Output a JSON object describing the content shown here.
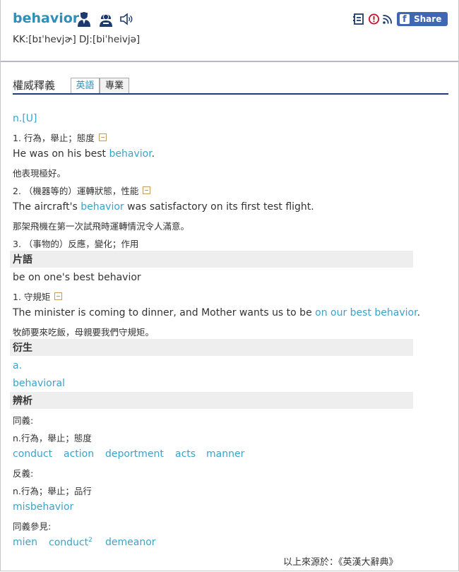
{
  "header": {
    "word": "behavior",
    "phonetic": "KK:[bɪˈhevjɚ] DJ:[biˈheivjə]",
    "voice_icons": [
      "male-voice-icon",
      "female-voice-icon",
      "speaker-icon"
    ],
    "tool_icons": [
      "notebook-icon",
      "report-icon",
      "rss-icon"
    ],
    "share_label": "Share 0"
  },
  "section": {
    "title": "權威釋義",
    "tabs": [
      {
        "label": "英語",
        "active": true
      },
      {
        "label": "專業",
        "active": false
      }
    ]
  },
  "entry": {
    "pos": "n.[U]",
    "senses": [
      {
        "num": "1.",
        "def": "行為，舉止；態度",
        "ex_pre": "He was on his best ",
        "ex_hl": "behavior",
        "ex_post": ".",
        "ex_zh": "他表現極好。"
      },
      {
        "num": "2.",
        "def": "（機器等的）運轉狀態，性能",
        "ex_pre": "The aircraft's ",
        "ex_hl": "behavior",
        "ex_post": " was satisfactory on its first test flight.",
        "ex_zh": "那架飛機在第一次試飛時運轉情況令人滿意。"
      },
      {
        "num": "3.",
        "def": "（事物的）反應，變化；作用"
      }
    ]
  },
  "phrases": {
    "heading": "片語",
    "phrase": "be on one's best behavior",
    "num": "1.",
    "def": "守規矩",
    "ex_pre": "The minister is coming to dinner, and Mother wants us to be ",
    "ex_hl": "on our best behavior",
    "ex_post": ".",
    "ex_zh": "牧師要來吃飯，母親要我們守規矩。"
  },
  "derived": {
    "heading": "衍生",
    "pos": "a.",
    "word": "behavioral"
  },
  "analysis": {
    "heading": "辨析",
    "syn_label": "同義:",
    "syn_def": "n.行為，舉止；態度",
    "synonyms": [
      "conduct",
      "action",
      "deportment",
      "acts",
      "manner"
    ],
    "ant_label": "反義:",
    "ant_def": "n.行為；舉止；品行",
    "antonyms": [
      "misbehavior"
    ],
    "see_label": "同義參見:",
    "see_also": [
      {
        "word": "mien",
        "sup": ""
      },
      {
        "word": "conduct",
        "sup": "2"
      },
      {
        "word": "demeanor",
        "sup": ""
      }
    ]
  },
  "source": "以上來源於：《英漢大辭典》"
}
